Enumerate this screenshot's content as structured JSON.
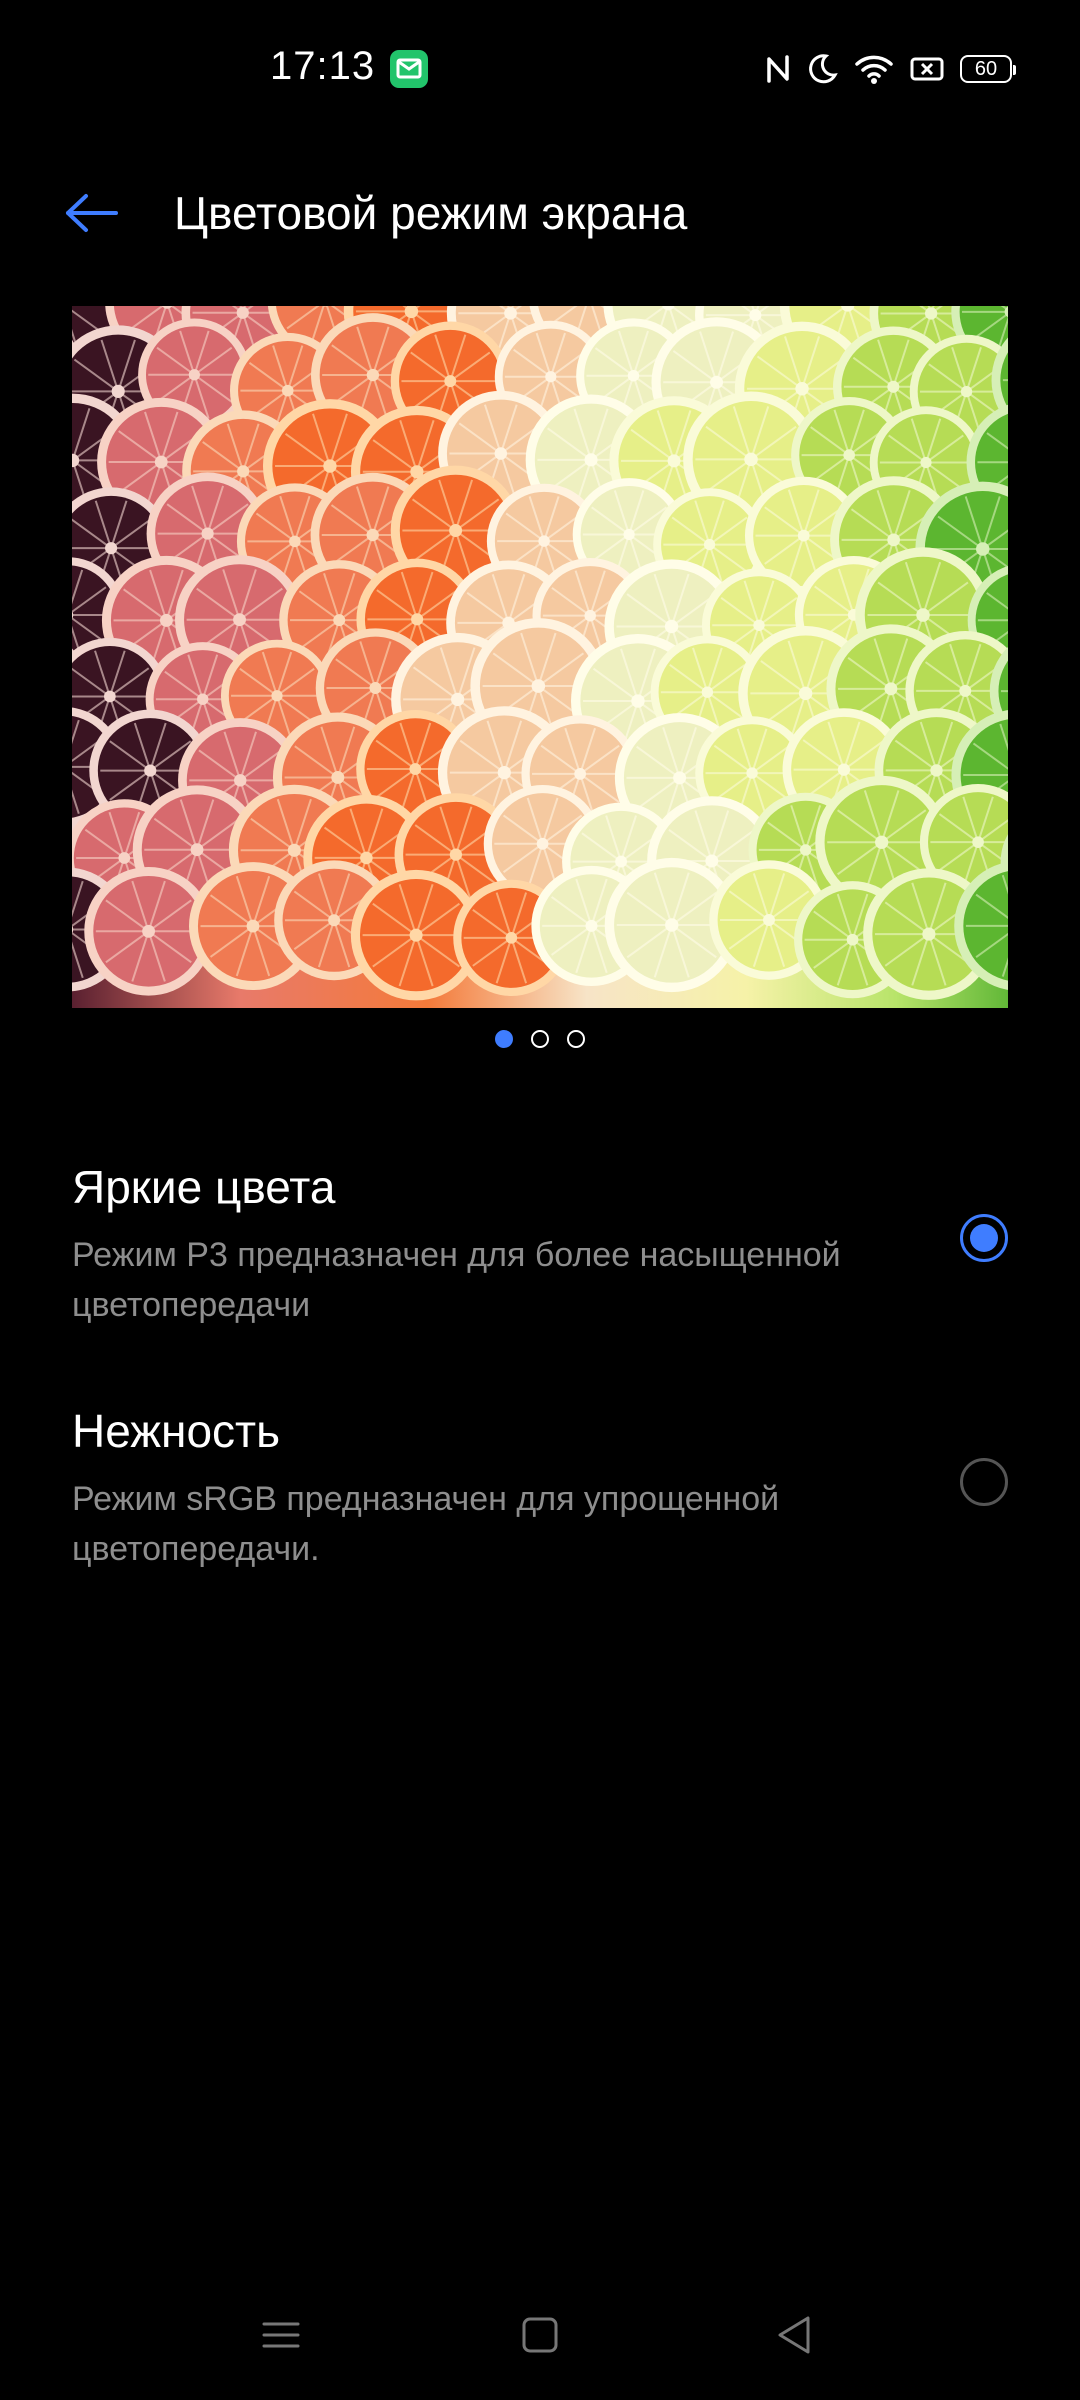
{
  "status_bar": {
    "time": "17:13",
    "notification_icon": "email-notification-icon",
    "icons": [
      "nfc-icon",
      "do-not-disturb-moon-icon",
      "wifi-icon",
      "sim-card-icon"
    ],
    "battery_level": "60"
  },
  "header": {
    "back_icon": "arrow-left-icon",
    "title": "Цветовой режим экрана"
  },
  "preview": {
    "image_subject": "citrus-slices-photo",
    "page_count": 3,
    "active_page": 1
  },
  "options": [
    {
      "title": "Яркие цвета",
      "description": "Режим P3 предназначен для более насыщенной цветопередачи",
      "selected": true
    },
    {
      "title": "Нежность",
      "description": "Режим sRGB предназначен для упрощенной цветопередачи.",
      "selected": false
    }
  ],
  "nav_bar": {
    "icons": [
      "menu-icon",
      "home-square-icon",
      "back-triangle-icon"
    ]
  },
  "colors": {
    "accent": "#3f7dff",
    "background": "#000000",
    "secondary_text": "#8e8e8e"
  }
}
